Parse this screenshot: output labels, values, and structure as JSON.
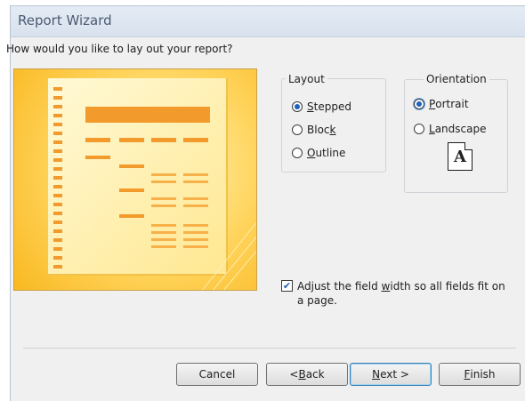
{
  "window": {
    "title": "Report Wizard"
  },
  "question": "How would you like to lay out your report?",
  "layout": {
    "label": "Layout",
    "options": [
      {
        "pre": "",
        "key": "S",
        "post": "tepped",
        "selected": true
      },
      {
        "pre": "Bloc",
        "key": "k",
        "post": "",
        "selected": false
      },
      {
        "pre": "",
        "key": "O",
        "post": "utline",
        "selected": false
      }
    ]
  },
  "orientation": {
    "label": "Orientation",
    "options": [
      {
        "pre": "",
        "key": "P",
        "post": "ortrait",
        "selected": true
      },
      {
        "pre": "",
        "key": "L",
        "post": "andscape",
        "selected": false
      }
    ],
    "icon_letter": "A"
  },
  "adjust": {
    "checked": true,
    "pre": "Adjust the field ",
    "key": "w",
    "post": "idth so all fields fit on a page."
  },
  "buttons": {
    "cancel": "Cancel",
    "back": {
      "pre": "< ",
      "key": "B",
      "post": "ack"
    },
    "next": {
      "key": "N",
      "post": "ext >"
    },
    "finish": {
      "key": "F",
      "post": "inish"
    }
  },
  "colors": {
    "preview_bg": "#ffd35a",
    "accent": "#f39a2c"
  }
}
